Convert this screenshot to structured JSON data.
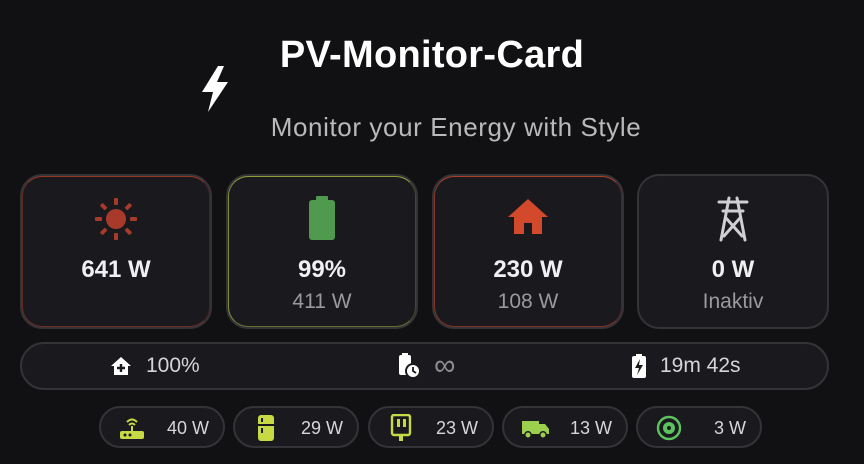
{
  "header": {
    "title": "PV-Monitor-Card",
    "subtitle": "Monitor your Energy with Style"
  },
  "tiles": [
    {
      "name": "solar",
      "icon": "sun-icon",
      "value": "641 W",
      "sub": "",
      "color": "#c0402a"
    },
    {
      "name": "battery",
      "icon": "battery-icon",
      "value": "99%",
      "sub": "411 W",
      "color": "#4f9a4f"
    },
    {
      "name": "house",
      "icon": "house-icon",
      "value": "230 W",
      "sub": "108 W",
      "color": "#d2492c"
    },
    {
      "name": "grid",
      "icon": "power-pylon-icon",
      "value": "0 W",
      "sub": "Inaktiv",
      "color": "#d0d0d4"
    }
  ],
  "stats": {
    "autarky": {
      "icon": "home-plus-icon",
      "value": "100%"
    },
    "runtime": {
      "icon": "battery-clock-icon",
      "value": "∞"
    },
    "charge_time": {
      "icon": "battery-charging-icon",
      "value": "19m 42s"
    }
  },
  "consumers": [
    {
      "name": "router",
      "icon": "router-icon",
      "value": "40 W",
      "color": "#c7d944"
    },
    {
      "name": "fridge",
      "icon": "fridge-icon",
      "value": "29 W",
      "color": "#c7d944"
    },
    {
      "name": "outlet",
      "icon": "power-plug-icon",
      "value": "23 W",
      "color": "#c7d944"
    },
    {
      "name": "van",
      "icon": "van-icon",
      "value": "13 W",
      "color": "#9ccf4d"
    },
    {
      "name": "heat-pump",
      "icon": "heat-pump-icon",
      "value": "3 W",
      "color": "#5cc35e"
    }
  ]
}
